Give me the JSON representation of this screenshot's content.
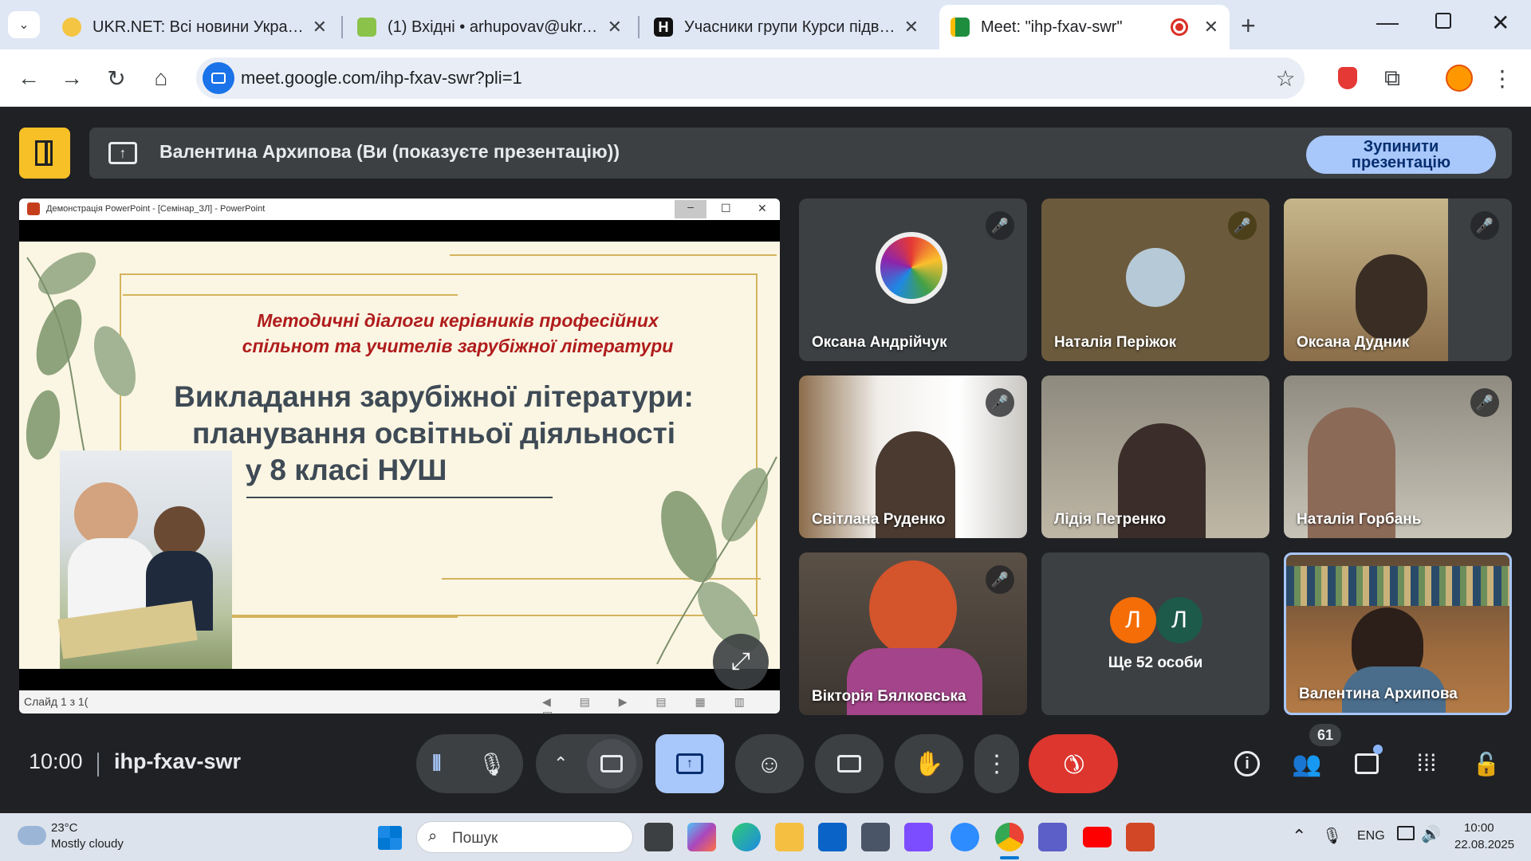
{
  "browser": {
    "tabs": [
      {
        "title": "UKR.NET: Всі новини України, с",
        "fav_color": "#f4c542"
      },
      {
        "title": "(1) Вхідні • arhupovav@ukr.net",
        "fav_color": "#8bc34a"
      },
      {
        "title": "Учасники групи Курси підвищ",
        "fav_color": "#111111"
      },
      {
        "title": "Meet: \"ihp-fxav-swr\"",
        "fav_color": "#1e8e3e"
      }
    ],
    "url": "meet.google.com/ihp-fxav-swr?pli=1"
  },
  "meet": {
    "banner_title": "Валентина Архипова (Ви (показуєте презентацію))",
    "stop_button_line1": "Зупинити",
    "stop_button_line2": "презентацію",
    "meeting_code": "ihp-fxav-swr",
    "time": "10:00",
    "participant_count": "61",
    "others_label": "Ще 52 особи",
    "others_initial_1": "Л",
    "others_initial_2": "Л",
    "participants": [
      {
        "name": "Оксана Андрійчук"
      },
      {
        "name": "Наталія Періжок"
      },
      {
        "name": "Оксана Дудник"
      },
      {
        "name": "Світлана Руденко"
      },
      {
        "name": "Лідія Петренко"
      },
      {
        "name": "Наталія Горбань"
      },
      {
        "name": "Вікторія Бялковська"
      },
      {
        "name": "Валентина Архипова"
      }
    ]
  },
  "presentation": {
    "window_title": "Демонстрація PowerPoint - [Семінар_ЗЛ] - PowerPoint",
    "subtitle_line1": "Методичні діалоги керівників професійних",
    "subtitle_line2": "спільнот та учителів зарубіжної літератури",
    "title_line1": "Викладання зарубіжної літератури:",
    "title_line2": "планування освітньої діяльності",
    "title_line3": "у 8 класі НУШ",
    "status": "Слайд 1 з 1("
  },
  "taskbar": {
    "weather_temp": "23°C",
    "weather_desc": "Mostly cloudy",
    "search_placeholder": "Пошук",
    "lang": "ENG",
    "time": "10:00",
    "date": "22.08.2025"
  }
}
